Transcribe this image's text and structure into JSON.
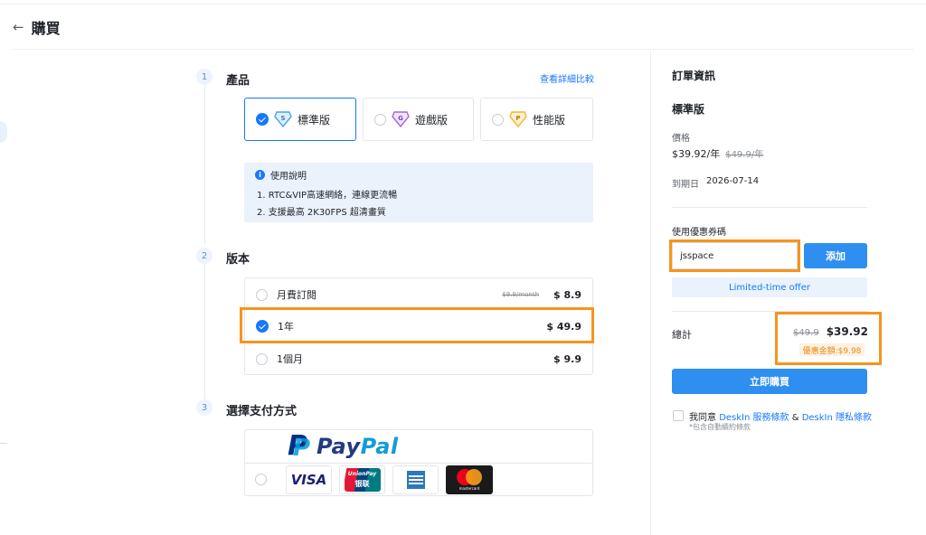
{
  "header": {
    "back_icon": "←",
    "title": "購買"
  },
  "steps": [
    {
      "num": "1",
      "title": "產品"
    },
    {
      "num": "2",
      "title": "版本"
    },
    {
      "num": "3",
      "title": "選擇支付方式"
    }
  ],
  "product": {
    "compare_link": "查看詳細比較",
    "options": [
      {
        "badge": "S",
        "label": "標準版",
        "selected": true,
        "badge_color": "#4aa3f0"
      },
      {
        "badge": "G",
        "label": "遊戲版",
        "selected": false,
        "badge_color": "#a06ad8"
      },
      {
        "badge": "P",
        "label": "性能版",
        "selected": false,
        "badge_color": "#f2b533"
      }
    ]
  },
  "usage": {
    "title": "使用說明",
    "lines": [
      "1. RTC&VIP高速網絡，連線更流暢",
      "2. 支援最高 2K30FPS 超清畫質"
    ]
  },
  "plans": [
    {
      "name": "月費訂閱",
      "old_price": "$9.9/month",
      "price": "$ 8.9",
      "selected": false
    },
    {
      "name": "1年",
      "old_price": "",
      "price": "$ 49.9",
      "selected": true
    },
    {
      "name": "1個月",
      "old_price": "",
      "price": "$ 9.9",
      "selected": false
    }
  ],
  "payment": {
    "paypal_brand": "Pay",
    "paypal_brand_2": "Pal",
    "cards": [
      "VISA",
      "UnionPay",
      "AMEX",
      "mastercard"
    ],
    "unionpay_sub": "银联"
  },
  "order": {
    "title": "訂單資訊",
    "edition": "標準版",
    "price_label": "價格",
    "price": "$39.92/年",
    "old_price": "$49.9/年",
    "expiry_label": "到期日",
    "expiry": "2026-07-14",
    "coupon_label": "使用優惠券碼",
    "coupon_value": "jsspace",
    "add_button": "添加",
    "offer": "Limited-time offer",
    "total_label": "總計",
    "total_old": "$49.9",
    "total": "$39.92",
    "discount": "優惠金額:$9.98",
    "buy_button": "立即購買",
    "agree_prefix": "我同意",
    "terms_link": "DeskIn 服務條款",
    "and": "&",
    "privacy_link": "DeskIn 隱私條款",
    "auto_renew_note": "*包含自動續約條款"
  },
  "colors": {
    "accent": "#1677ff",
    "button": "#2e8ff0",
    "highlight": "#f7941d",
    "discount": "#e88a1a"
  }
}
